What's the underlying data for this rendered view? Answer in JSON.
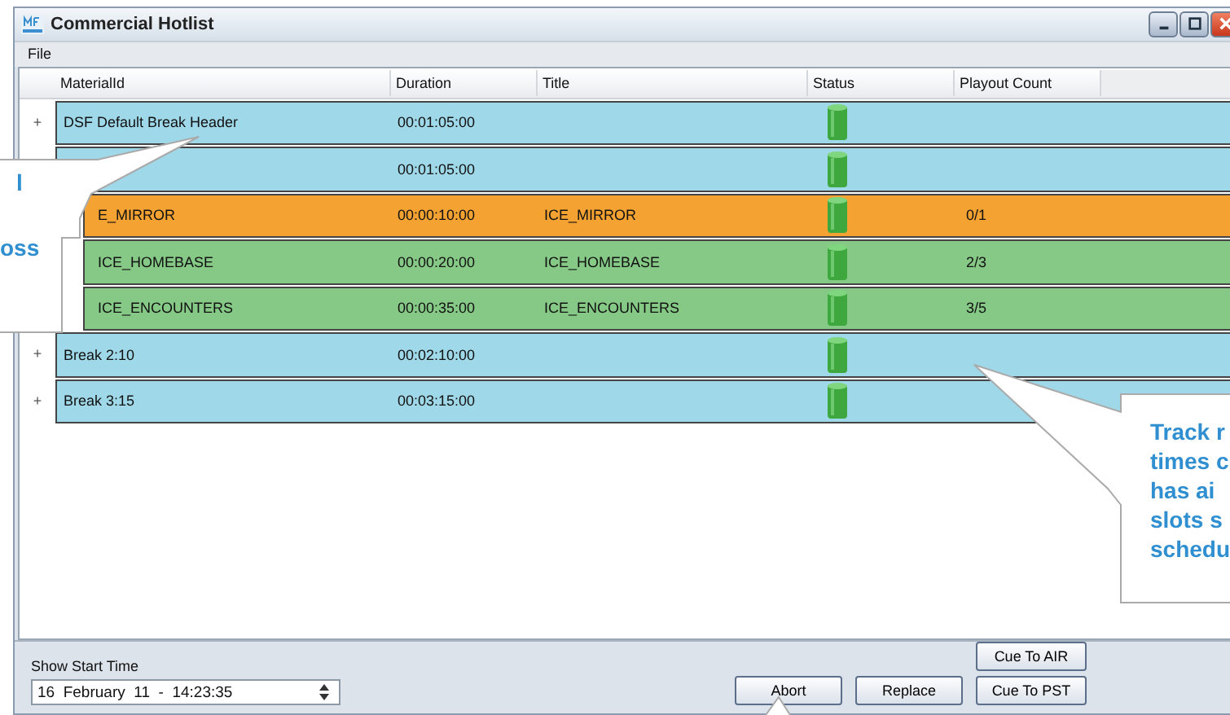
{
  "window": {
    "title": "Commercial Hotlist"
  },
  "menu": [
    "File"
  ],
  "columns": [
    "MaterialId",
    "Duration",
    "Title",
    "Status",
    "Playout Count"
  ],
  "rows": [
    {
      "toggle": "+",
      "material_id": "DSF Default Break Header",
      "duration": "00:01:05:00",
      "color": "#9fd8e8"
    },
    {
      "duration": "00:01:05:00",
      "color": "#9fd8e8",
      "children": [
        {
          "material_id": "E_MIRROR",
          "duration": "00:00:10:00",
          "title": "ICE_MIRROR",
          "playout_count": "0/1",
          "color": "#f4a232"
        },
        {
          "material_id": "ICE_HOMEBASE",
          "duration": "00:00:20:00",
          "title": "ICE_HOMEBASE",
          "playout_count": "2/3",
          "color": "#86c986"
        },
        {
          "material_id": "ICE_ENCOUNTERS",
          "duration": "00:00:35:00",
          "title": "ICE_ENCOUNTERS",
          "playout_count": "3/5",
          "color": "#86c986"
        }
      ]
    },
    {
      "toggle": "+",
      "material_id": "Break 2:10",
      "duration": "00:02:10:00",
      "color": "#9fd8e8"
    },
    {
      "toggle": "+",
      "material_id": "Break 3:15",
      "duration": "00:03:15:00",
      "color": "#9fd8e8"
    }
  ],
  "show_start_time": {
    "label": "Show Start Time",
    "value": "16  February  11  -  14:23:35"
  },
  "buttons": [
    "Abort",
    "Replace"
  ],
  "cue_buttons": [
    "Cue To AIR",
    "Cue To PST"
  ],
  "callouts": [
    {
      "lines": [
        "l",
        "oss"
      ]
    },
    {
      "lines": [
        "Track r",
        "times c",
        "has ai",
        "slots s",
        "schedu"
      ]
    }
  ]
}
